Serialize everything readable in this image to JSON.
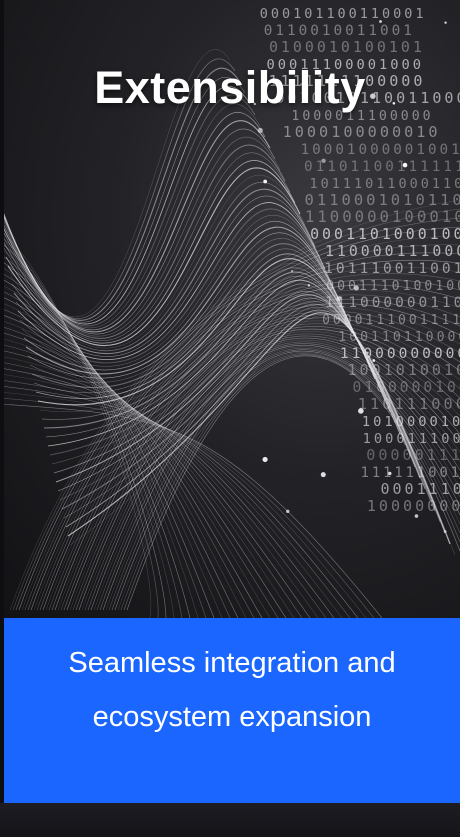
{
  "card": {
    "title": "Extensibility",
    "caption_line1": "Seamless integration and",
    "caption_line2": "ecosystem expansion"
  },
  "colors": {
    "accent_panel": "#1a66ff",
    "background": "#141419",
    "text": "#ffffff"
  },
  "icons": [
    "fiber-curves-graphic",
    "binary-code-graphic"
  ]
}
